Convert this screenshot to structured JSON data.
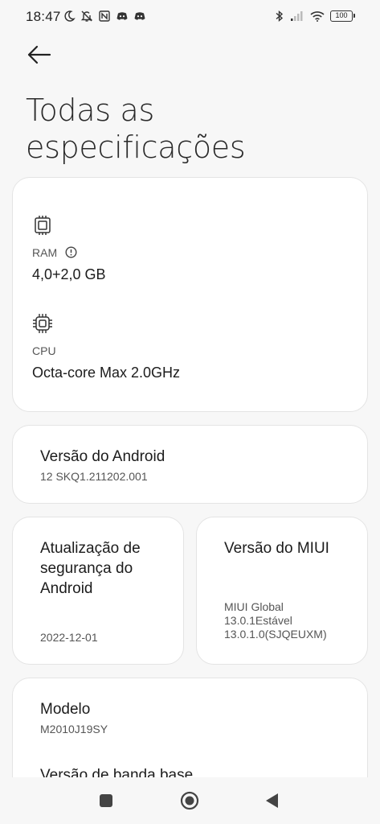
{
  "status_bar": {
    "time": "18:47",
    "battery": "100",
    "icons": [
      "moon-icon",
      "bell-off-icon",
      "nfc-icon",
      "discord-icon",
      "discord-icon",
      "bluetooth-icon",
      "signal-icon",
      "wifi-icon",
      "battery-icon"
    ]
  },
  "page": {
    "title_line1": "Todas as",
    "title_line2": "especificações"
  },
  "hardware": {
    "ram_label": "RAM",
    "ram_value": "4,0+2,0 GB",
    "cpu_label": "CPU",
    "cpu_value": "Octa-core Max 2.0GHz"
  },
  "android": {
    "label": "Versão do Android",
    "value": "12 SKQ1.211202.001"
  },
  "security": {
    "label_line1": "Atualização de",
    "label_line2": "segurança do",
    "label_line3": "Android",
    "value": "2022-12-01"
  },
  "miui": {
    "label": "Versão do MIUI",
    "value_line1": "MIUI Global",
    "value_line2": "13.0.1Estável",
    "value_line3": "13.0.1.0(SJQEUXM)"
  },
  "model": {
    "label": "Modelo",
    "value": "M2010J19SY",
    "baseband_label": "Versão de banda base"
  },
  "colors": {
    "background": "#f7f7f7",
    "card": "#ffffff",
    "text_primary": "#1c1c1c",
    "text_secondary": "#555555"
  }
}
